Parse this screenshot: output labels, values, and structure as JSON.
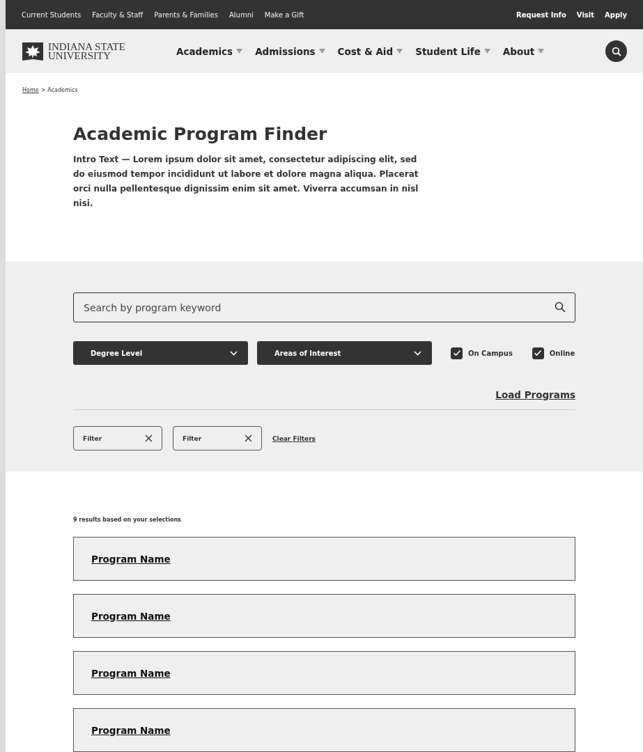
{
  "utility_nav": {
    "left": [
      "Current Students",
      "Faculty & Staff",
      "Parents & Families",
      "Alumni",
      "Make a Gift"
    ],
    "right": [
      "Request Info",
      "Visit",
      "Apply"
    ]
  },
  "logo": {
    "line1": "INDIANA STATE",
    "line2": "UNIVERSITY"
  },
  "main_nav": [
    "Academics",
    "Admissions",
    "Cost & Aid",
    "Student Life",
    "About"
  ],
  "breadcrumb": {
    "link": "Home",
    "separator": ">",
    "current": "Academics"
  },
  "title": "Academic Program Finder",
  "intro": "Intro Text — Lorem ipsum dolor sit amet, consectetur adipiscing elit, sed do eiusmod tempor incididunt ut labore et dolore magna aliqua. Placerat orci nulla pellentesque dignissim enim sit amet. Viverra accumsan in nisl nisi.",
  "search": {
    "placeholder": "Search by program keyword"
  },
  "dropdowns": [
    "Degree Level",
    "Areas of Interest"
  ],
  "checkboxes": [
    {
      "label": "On Campus",
      "checked": true
    },
    {
      "label": "Online",
      "checked": true
    }
  ],
  "load_link": "Load Programs",
  "filters": [
    "Filter",
    "Filter"
  ],
  "clear_link": "Clear Filters",
  "results_count": "9 results based on your selections",
  "programs": [
    "Program Name",
    "Program Name",
    "Program Name",
    "Program Name"
  ]
}
